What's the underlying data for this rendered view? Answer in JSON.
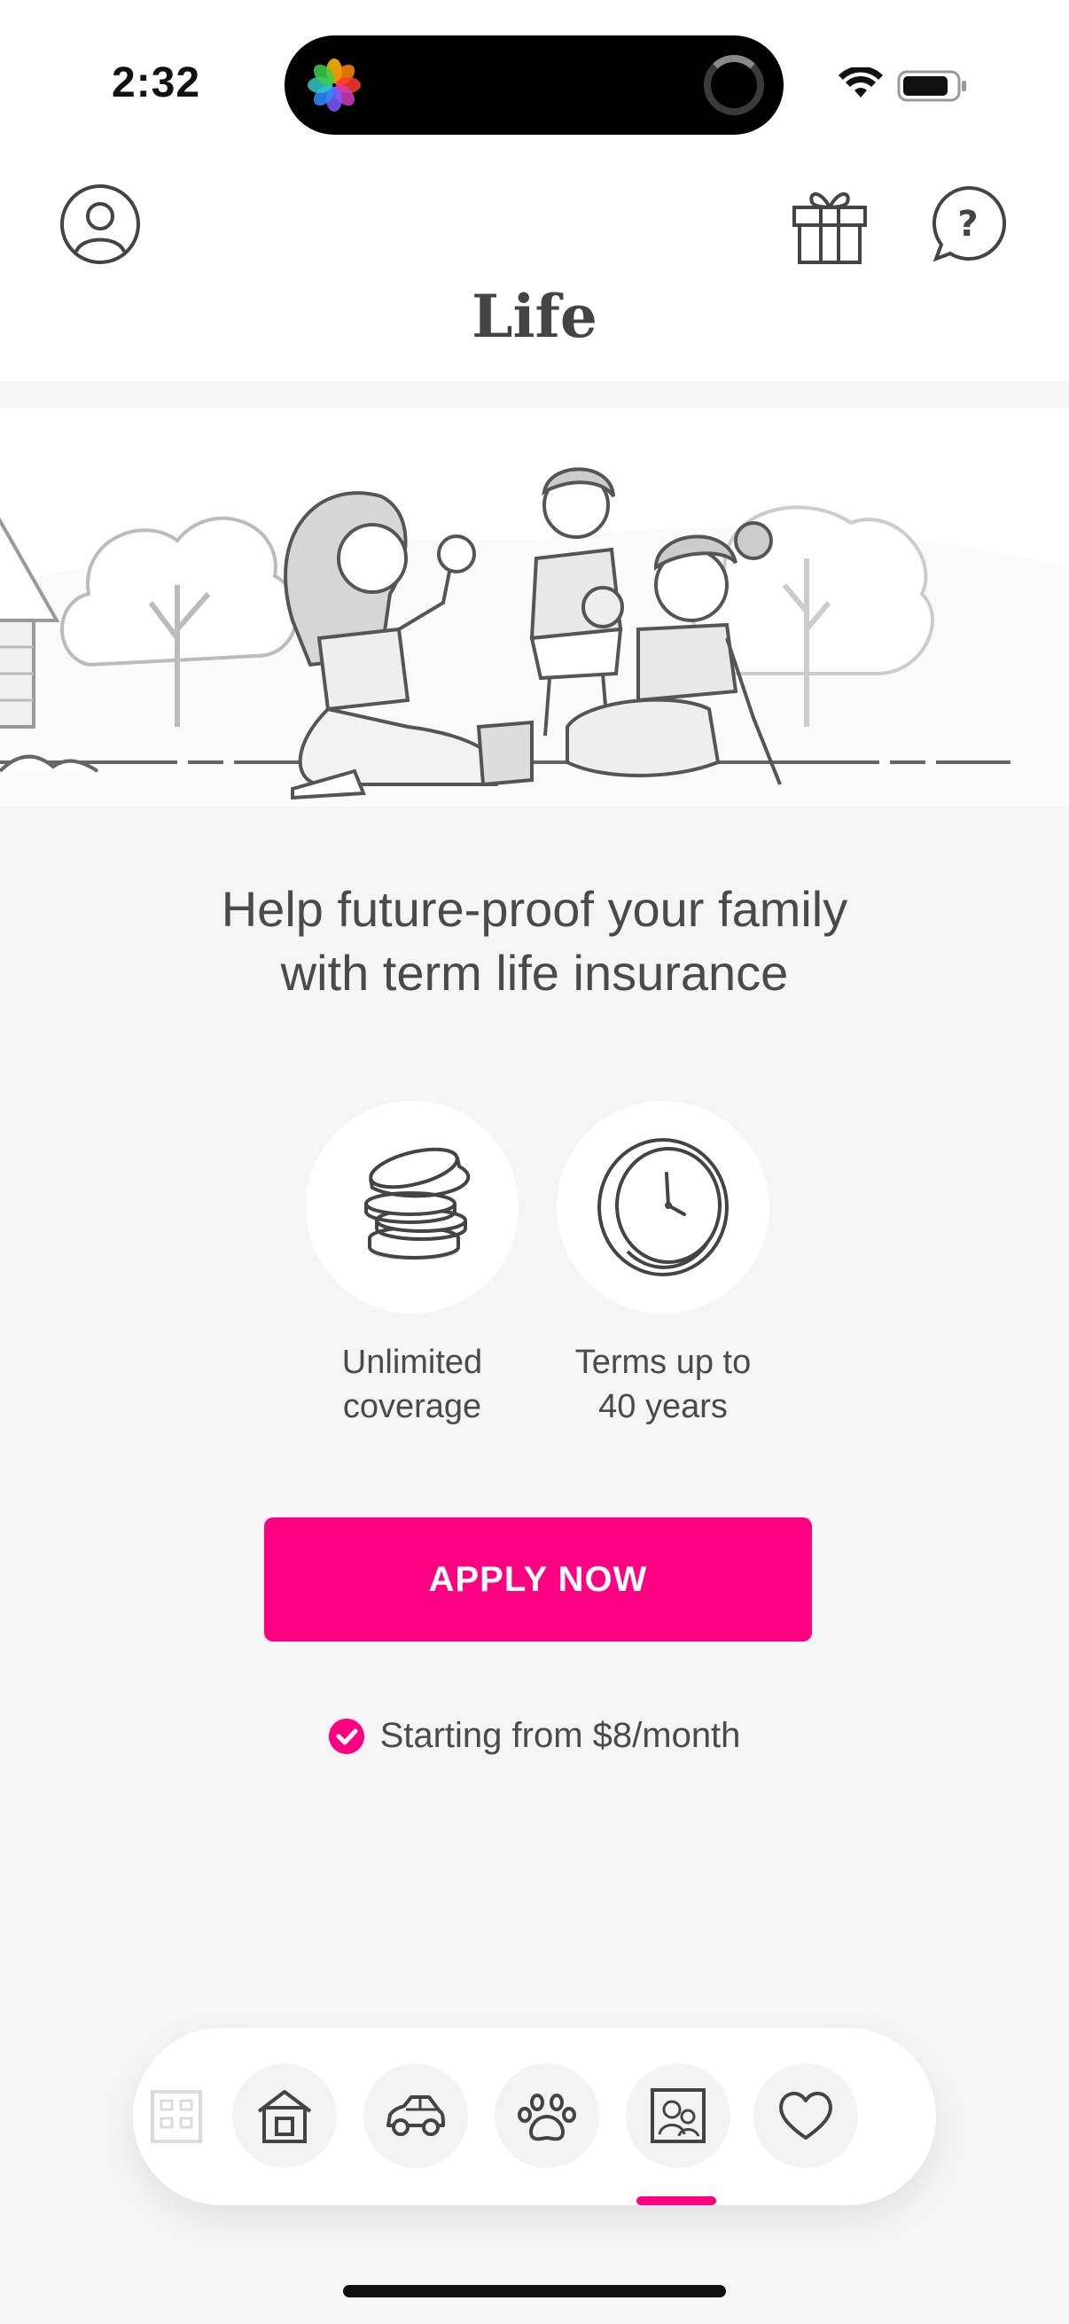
{
  "status_bar": {
    "time": "2:32"
  },
  "header": {
    "title": "Life"
  },
  "main": {
    "headline_line1": "Help future-proof your family",
    "headline_line2": "with term life insurance",
    "features": [
      {
        "icon": "coins-icon",
        "line1": "Unlimited",
        "line2": "coverage"
      },
      {
        "icon": "clock-icon",
        "line1": "Terms up to",
        "line2": "40 years"
      }
    ],
    "apply_label": "APPLY NOW",
    "price_note": "Starting from $8/month"
  },
  "bottom_nav": {
    "items": [
      "building-icon",
      "home-icon",
      "car-icon",
      "paw-icon",
      "photo-frame-icon",
      "heart-icon"
    ],
    "active": "photo-frame-icon"
  },
  "colors": {
    "accent": "#ff0083",
    "background": "#f5f5f5",
    "text": "#4a4a4a"
  }
}
